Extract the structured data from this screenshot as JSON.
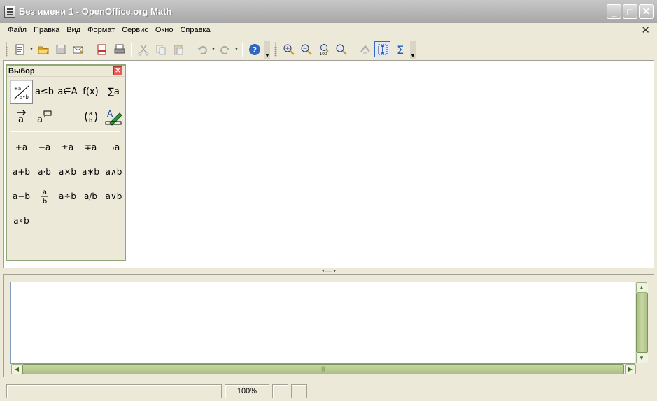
{
  "window": {
    "title": "Без имени 1 - OpenOffice.org Math",
    "buttons": {
      "minimize": "_",
      "maximize": "□",
      "close": "✕"
    }
  },
  "menubar": {
    "items": [
      "Файл",
      "Правка",
      "Вид",
      "Формат",
      "Сервис",
      "Окно",
      "Справка"
    ],
    "close_glyph": "✕"
  },
  "toolbar": {
    "icons": [
      "new-document-icon",
      "open-folder-icon",
      "save-icon",
      "email-icon",
      "export-pdf-icon",
      "print-icon",
      "cut-icon",
      "copy-icon",
      "paste-icon",
      "undo-icon",
      "redo-icon",
      "help-icon",
      "zoom-in-icon",
      "zoom-out-icon",
      "zoom-100-icon",
      "zoom-page-icon",
      "refresh-icon",
      "formula-cursor-icon",
      "symbols-icon"
    ],
    "zoom100_label": "100"
  },
  "selection_panel": {
    "title": "Выбор",
    "categories": [
      "+a/a•b",
      "a≤b",
      "a∈A",
      "f(x)",
      "∑a",
      "a⃗",
      "a‿",
      "",
      "(a b)",
      "A✎"
    ],
    "symbols": [
      "+a",
      "−a",
      "±a",
      "∓a",
      "¬a",
      "a+b",
      "a⋅b",
      "a×b",
      "a∗b",
      "a∧b",
      "a−b",
      "a/b",
      "a÷b",
      "a/b",
      "a∨b",
      "a∘b"
    ]
  },
  "command_area": {
    "text": ""
  },
  "statusbar": {
    "zoom": "100%"
  },
  "colors": {
    "title_bar": "#b4b4b4",
    "window_bg": "#ece9d8",
    "scroll_thumb": "#a9bf84",
    "panel_border": "#8fa876"
  }
}
